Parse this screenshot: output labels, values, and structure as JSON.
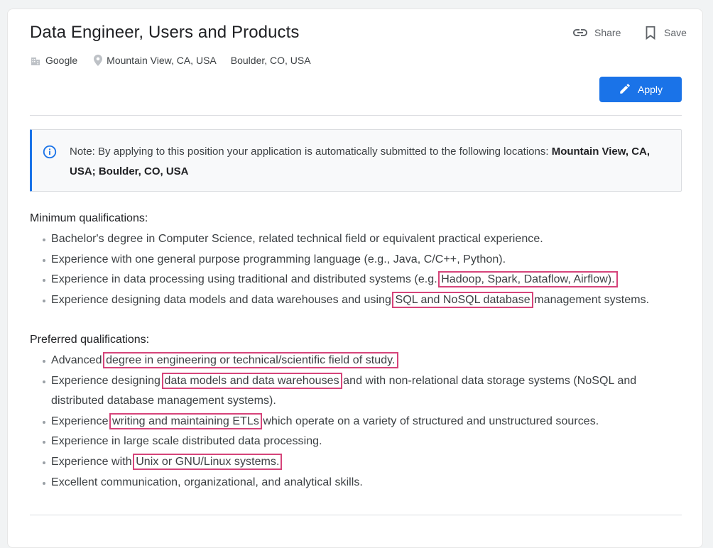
{
  "job": {
    "title": "Data Engineer, Users and Products",
    "company": "Google",
    "locations": [
      "Mountain View, CA, USA",
      "Boulder, CO, USA"
    ]
  },
  "actions": {
    "share_label": "Share",
    "save_label": "Save",
    "apply_label": "Apply"
  },
  "note": {
    "prefix": "Note: By applying to this position your application is automatically submitted to the following locations: ",
    "locations_bold": "Mountain View, CA, USA; Boulder, CO, USA"
  },
  "minimum": {
    "heading": "Minimum qualifications:",
    "items": [
      {
        "before": "Bachelor's degree in Computer Science, related technical field or equivalent practical experience.",
        "hl": "",
        "after": ""
      },
      {
        "before": "Experience with one general purpose programming language (e.g., Java, C/C++, Python).",
        "hl": "",
        "after": ""
      },
      {
        "before": "Experience in data processing using traditional and distributed systems (e.g. ",
        "hl": "Hadoop, Spark, Dataflow, Airflow).",
        "after": ""
      },
      {
        "before": "Experience designing data models and data warehouses and using ",
        "hl": "SQL and NoSQL database",
        "after": " management systems."
      }
    ]
  },
  "preferred": {
    "heading": "Preferred qualifications:",
    "items": [
      {
        "before": "Advanced ",
        "hl": "degree in engineering or technical/scientific field of study.",
        "after": ""
      },
      {
        "before": "Experience designing ",
        "hl": "data models and data warehouses",
        "after": " and with non-relational data storage systems (NoSQL and distributed database management systems)."
      },
      {
        "before": "Experience ",
        "hl": "writing and maintaining ETLs",
        "after": " which operate on a variety of structured and unstructured sources."
      },
      {
        "before": "Experience in large scale distributed data processing.",
        "hl": "",
        "after": ""
      },
      {
        "before": "Experience with ",
        "hl": "Unix or GNU/Linux systems.",
        "after": ""
      },
      {
        "before": "Excellent communication, organizational, and analytical skills.",
        "hl": "",
        "after": ""
      }
    ]
  },
  "colors": {
    "accent": "#1a73e8",
    "highlight_box": "#d6447a",
    "note_background": "#f8f9fa"
  },
  "icons": {
    "share": "link-icon",
    "save": "bookmark-icon",
    "company": "building-icon",
    "location": "location-pin-icon",
    "apply": "pencil-icon",
    "note": "info-icon"
  }
}
